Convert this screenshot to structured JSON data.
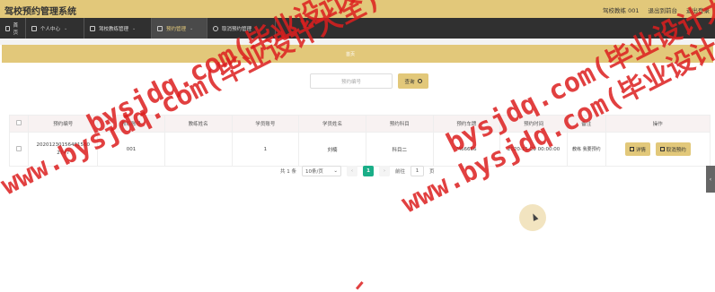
{
  "header": {
    "app_title": "驾校预约管理系统",
    "user": "驾校教练 001",
    "back_to_front": "退出到前台",
    "logout": "退出登录"
  },
  "nav": {
    "items": [
      {
        "label": "首页",
        "icon": "home-icon"
      },
      {
        "label": "个人中心",
        "icon": "user-icon"
      },
      {
        "label": "驾校教练管理",
        "icon": "grid-icon"
      },
      {
        "label": "预约管理",
        "icon": "mic-icon"
      },
      {
        "label": "取消预约管理",
        "icon": "circle-icon"
      }
    ]
  },
  "banner": {
    "text": "首页"
  },
  "search": {
    "label": "预约编号",
    "placeholder": "预约编号",
    "button": "查询"
  },
  "table": {
    "headers": [
      "预约编号",
      "教练账号",
      "教练姓名",
      "学员账号",
      "学员姓名",
      "预约科目",
      "预约车牌",
      "预约时间",
      "备注",
      "操作"
    ],
    "rows": [
      {
        "order_id_line1": "20201230156461580",
        "order_id_line2": "2747",
        "coach_account": "001",
        "coach_name": "",
        "student_account": "1",
        "student_name": "刘楠",
        "subject": "科目二",
        "plate": "M66666",
        "time": "2020-11-29 00:00:00",
        "remark": "教练 我要预约",
        "detail_btn": "详情",
        "cancel_btn": "取消预约"
      }
    ]
  },
  "pager": {
    "total": "共 1 条",
    "page_size": "10条/页",
    "current": "1",
    "goto_label": "前往",
    "goto_value": "1",
    "page_unit": "页"
  },
  "watermark": {
    "w1": "www.bysjdq.com(毕业设计大全)",
    "w2": "www.bysjdq.com(毕业设计大全)",
    "w3": "bysjdq.com(毕业设计大全)",
    "w4": "bysjdq.com(毕业设计大全)"
  },
  "colors": {
    "accent": "#e2c87a",
    "nav_bg": "#303030",
    "page_active": "#1aae88"
  }
}
